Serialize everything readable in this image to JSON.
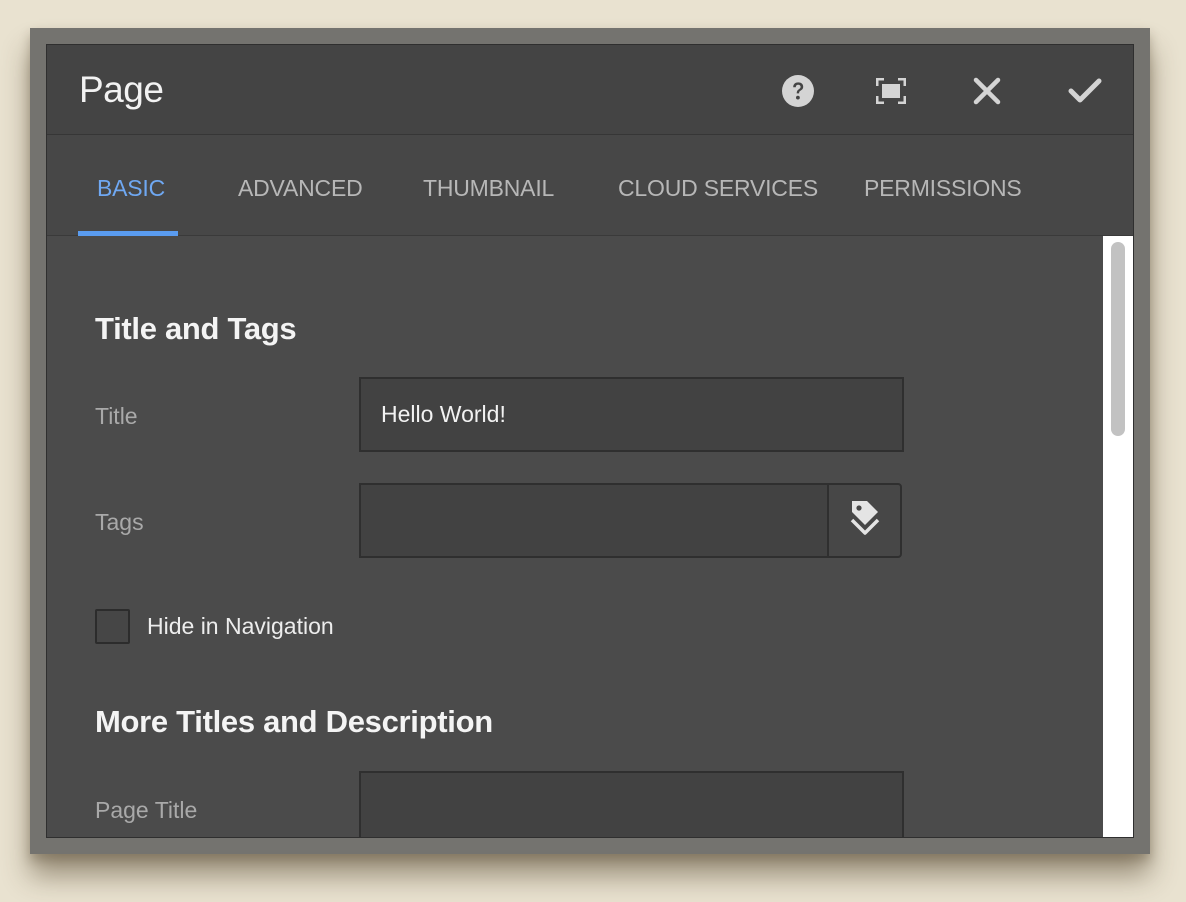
{
  "dialog": {
    "title": "Page",
    "actions": [
      {
        "name": "help-icon"
      },
      {
        "name": "fullscreen-icon"
      },
      {
        "name": "close-icon"
      },
      {
        "name": "checkmark-icon"
      }
    ]
  },
  "tabs": [
    {
      "label": "BASIC",
      "active": true
    },
    {
      "label": "ADVANCED",
      "active": false
    },
    {
      "label": "THUMBNAIL",
      "active": false
    },
    {
      "label": "CLOUD SERVICES",
      "active": false
    },
    {
      "label": "PERMISSIONS",
      "active": false
    }
  ],
  "sections": {
    "title_and_tags": {
      "heading": "Title and Tags",
      "title_label": "Title",
      "title_value": "Hello World!",
      "tags_label": "Tags",
      "tags_value": "",
      "tags_button_icon": "tag-icon",
      "hide_in_nav_label": "Hide in Navigation",
      "hide_in_nav_checked": false
    },
    "more_titles": {
      "heading": "More Titles and Description",
      "page_title_label": "Page Title",
      "page_title_value": ""
    }
  },
  "colors": {
    "accent": "#5a9cf0",
    "tab_active_text": "#6fa8f2",
    "dialog_bg": "#4b4b4b",
    "titlebar_bg": "#444444",
    "backdrop": "#e9e2d0"
  }
}
